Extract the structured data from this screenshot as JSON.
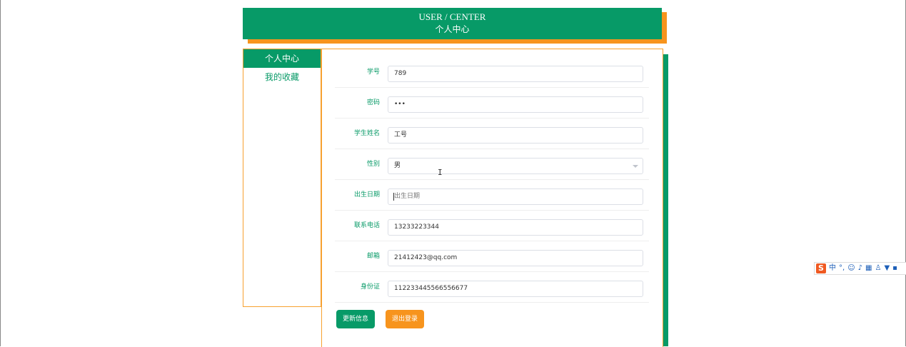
{
  "header": {
    "title_en": "USER / CENTER",
    "title_cn": "个人中心"
  },
  "sidebar": {
    "items": [
      {
        "label": "个人中心",
        "active": true
      },
      {
        "label": "我的收藏",
        "active": false
      }
    ]
  },
  "form": {
    "fields": [
      {
        "label": "学号",
        "value": "789"
      },
      {
        "label": "密码",
        "value": "•••"
      },
      {
        "label": "学生姓名",
        "value": "工号"
      },
      {
        "label": "性别",
        "value": "男"
      },
      {
        "label": "出生日期",
        "value": "",
        "placeholder": "出生日期"
      },
      {
        "label": "联系电话",
        "value": "13233223344"
      },
      {
        "label": "邮箱",
        "value": "21412423@qq.com"
      },
      {
        "label": "身份证",
        "value": "112233445566556677"
      }
    ]
  },
  "buttons": {
    "update": "更新信息",
    "logout": "退出登录"
  },
  "ime": {
    "logo": "S",
    "lang": "中",
    "punct": "°,",
    "icons": [
      "emoji-icon",
      "mic-icon",
      "keyboard-icon",
      "user-icon",
      "shirt-icon",
      "grid-icon"
    ]
  },
  "colors": {
    "primary": "#079a67",
    "accent": "#f7941d"
  }
}
